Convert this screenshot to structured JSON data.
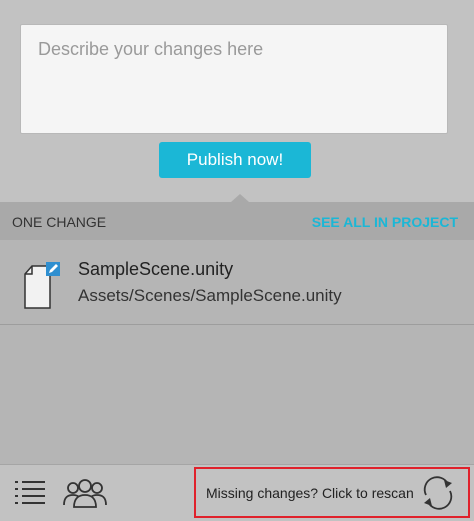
{
  "description": {
    "placeholder": "Describe your changes here"
  },
  "publish": {
    "label": "Publish now!"
  },
  "changes": {
    "count_label": "ONE CHANGE",
    "see_all_label": "SEE ALL IN PROJECT",
    "items": [
      {
        "name": "SampleScene.unity",
        "path": "Assets/Scenes/SampleScene.unity",
        "icon": "modified-file-icon"
      }
    ]
  },
  "footer": {
    "rescan_label": "Missing changes? Click to rescan",
    "icons": [
      "list-icon",
      "users-icon",
      "refresh-icon"
    ]
  },
  "colors": {
    "accent": "#1bb7d6",
    "highlight_border": "#e0212b"
  }
}
